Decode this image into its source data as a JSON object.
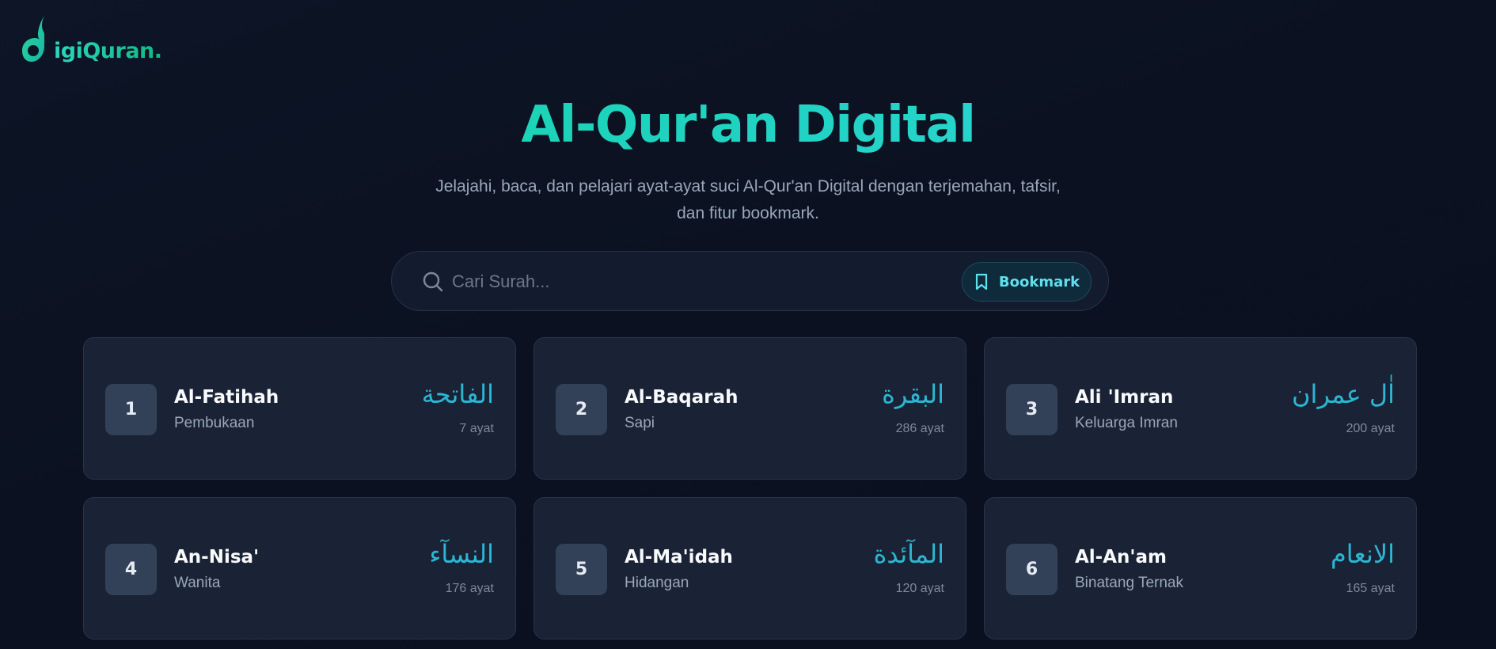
{
  "brand": {
    "logo_text": "igiQuran.",
    "logo_letter": "d"
  },
  "hero": {
    "title": "Al-Qur'an Digital",
    "subtitle": "Jelajahi, baca, dan pelajari ayat-ayat suci Al-Qur'an Digital dengan terjemahan, tafsir, dan fitur bookmark."
  },
  "search": {
    "placeholder": "Cari Surah...",
    "value": "",
    "icon": "search-icon"
  },
  "bookmark_button": {
    "label": "Bookmark",
    "icon": "bookmark-icon"
  },
  "colors": {
    "accent": "#2dd4bf",
    "arabic_text": "#2bb7d4",
    "background": "#0b1120",
    "card": "#1a2335"
  },
  "surahs": [
    {
      "number": "1",
      "name": "Al-Fatihah",
      "meaning": "Pembukaan",
      "arabic": "الفاتحة",
      "ayat": "7 ayat"
    },
    {
      "number": "2",
      "name": "Al-Baqarah",
      "meaning": "Sapi",
      "arabic": "البقرة",
      "ayat": "286 ayat"
    },
    {
      "number": "3",
      "name": "Ali 'Imran",
      "meaning": "Keluarga Imran",
      "arabic": "اٰل عمران",
      "ayat": "200 ayat"
    },
    {
      "number": "4",
      "name": "An-Nisa'",
      "meaning": "Wanita",
      "arabic": "النسآء",
      "ayat": "176 ayat"
    },
    {
      "number": "5",
      "name": "Al-Ma'idah",
      "meaning": "Hidangan",
      "arabic": "المآئدة",
      "ayat": "120 ayat"
    },
    {
      "number": "6",
      "name": "Al-An'am",
      "meaning": "Binatang Ternak",
      "arabic": "الانعام",
      "ayat": "165 ayat"
    }
  ]
}
